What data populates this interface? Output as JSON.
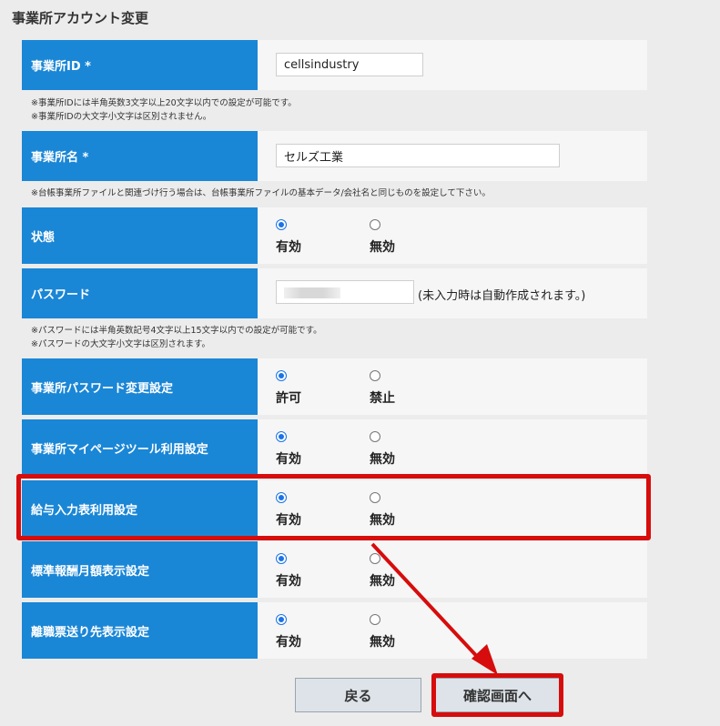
{
  "page": {
    "title": "事業所アカウント変更"
  },
  "form": {
    "office_id": {
      "label": "事業所ID *",
      "value": "cellsindustry",
      "notes": [
        "※事業所IDには半角英数3文字以上20文字以内での設定が可能です。",
        "※事業所IDの大文字小文字は区別されません。"
      ]
    },
    "office_name": {
      "label": "事業所名 *",
      "value": "セルズ工業",
      "note": "※台帳事業所ファイルと関連づけ行う場合は、台帳事業所ファイルの基本データ/会社名と同じものを設定して下さい。"
    },
    "status": {
      "label": "状態",
      "options": [
        "有効",
        "無効"
      ],
      "selected": "有効"
    },
    "password": {
      "label": "パスワード",
      "hint": "(未入力時は自動作成されます。)",
      "notes": [
        "※パスワードには半角英数記号4文字以上15文字以内での設定が可能です。",
        "※パスワードの大文字小文字は区別されます。"
      ]
    },
    "pw_change": {
      "label": "事業所パスワード変更設定",
      "options": [
        "許可",
        "禁止"
      ],
      "selected": "許可"
    },
    "mypage_tool": {
      "label": "事業所マイページツール利用設定",
      "options": [
        "有効",
        "無効"
      ],
      "selected": "有効"
    },
    "salary_input": {
      "label": "給与入力表利用設定",
      "options": [
        "有効",
        "無効"
      ],
      "selected": "有効"
    },
    "standard_pay": {
      "label": "標準報酬月額表示設定",
      "options": [
        "有効",
        "無効"
      ],
      "selected": "有効"
    },
    "separation_slip": {
      "label": "離職票送り先表示設定",
      "options": [
        "有効",
        "無効"
      ],
      "selected": "有効"
    }
  },
  "buttons": {
    "back": "戻る",
    "confirm": "確認画面へ"
  },
  "annotation_color": "#d70c0c",
  "accent_color": "#1a86d6"
}
